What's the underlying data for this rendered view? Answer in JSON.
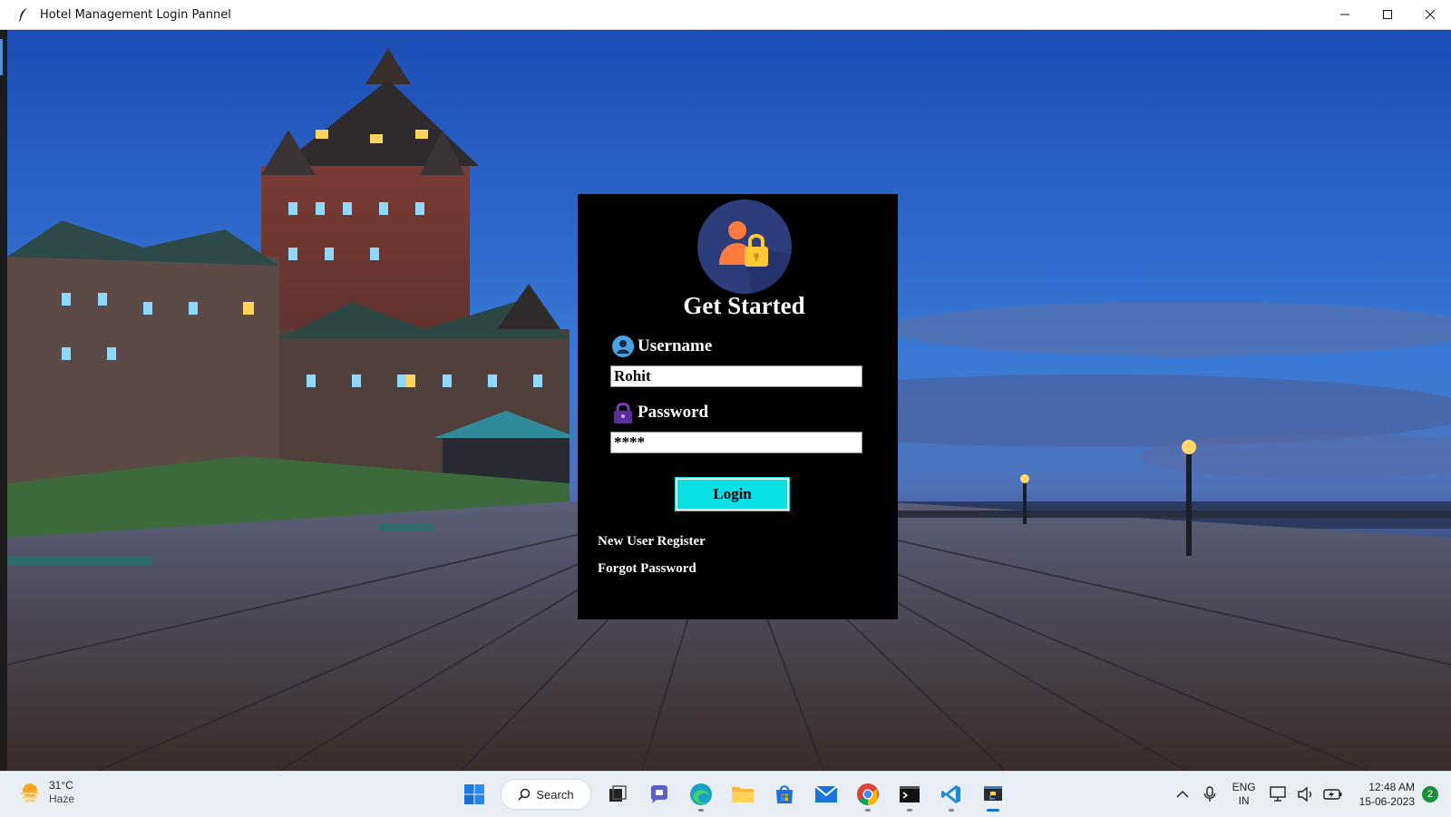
{
  "window": {
    "title": "Hotel Management Login Pannel",
    "icon": "feather-icon",
    "controls": [
      "minimize-icon",
      "maximize-icon",
      "close-icon"
    ]
  },
  "login": {
    "heading": "Get Started",
    "username_label": "Username",
    "username_value": "Rohit",
    "password_label": "Password",
    "password_value": "****",
    "login_button": "Login",
    "register_link": "New User Register",
    "forgot_link": "Forgot Password"
  },
  "taskbar": {
    "weather_temp": "31°C",
    "weather_desc": "Haze",
    "search_label": "Search",
    "pinned_apps": [
      "start-icon",
      "search",
      "task-view-icon",
      "teams-chat-icon",
      "edge-icon",
      "file-explorer-icon",
      "store-icon",
      "mail-icon",
      "chrome-icon",
      "terminal-icon",
      "vscode-icon",
      "python-idle-icon"
    ],
    "lang_line1": "ENG",
    "lang_line2": "IN",
    "time": "12:48 AM",
    "date": "15-06-2023",
    "notification_count": "2"
  },
  "colors": {
    "panel_bg": "#000000",
    "login_button_bg": "#08e0e6",
    "text_on_panel": "#ffffff"
  }
}
